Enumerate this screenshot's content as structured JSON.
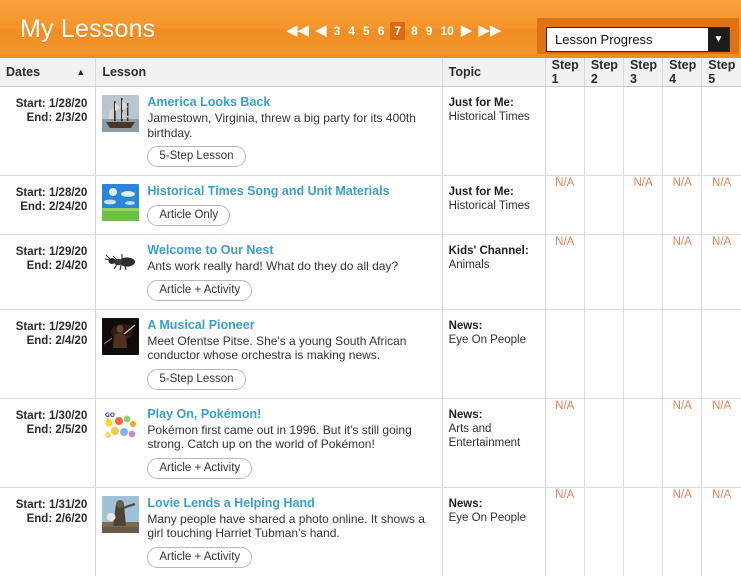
{
  "header": {
    "title": "My Lessons",
    "accent_color": "#f08c22",
    "pagination": {
      "first_icon": "double-left-arrow-icon",
      "prev_icon": "left-arrow-icon",
      "next_icon": "right-arrow-icon",
      "last_icon": "double-right-arrow-icon",
      "pages": [
        "3",
        "4",
        "5",
        "6",
        "7",
        "8",
        "9",
        "10"
      ],
      "current_page": "7"
    },
    "dropdown": {
      "selected": "Lesson Progress",
      "arrow_icon": "chevron-down-icon",
      "options": [
        "Lesson Progress"
      ]
    }
  },
  "table": {
    "columns": {
      "dates": "Dates",
      "sort_icon": "sort-ascending-icon",
      "lesson": "Lesson",
      "topic": "Topic",
      "steps": [
        "Step 1",
        "Step 2",
        "Step 3",
        "Step 4",
        "Step 5"
      ]
    },
    "labels": {
      "start": "Start:",
      "end": "End:"
    },
    "rows": [
      {
        "start": "1/28/20",
        "end": "2/3/20",
        "thumb": "sailing-ship-thumbnail",
        "title": "America Looks Back",
        "desc": "Jamestown, Virginia, threw a big party for its 400th birthday.",
        "pill": "5-Step Lesson",
        "topic_cat": "Just for Me:",
        "topic_sub": "Historical Times",
        "steps": [
          "",
          "",
          "",
          "",
          ""
        ]
      },
      {
        "start": "1/28/20",
        "end": "2/24/20",
        "thumb": "blue-sky-field-thumbnail",
        "title": "Historical Times Song and Unit Materials",
        "desc": "",
        "pill": "Article Only",
        "topic_cat": "Just for Me:",
        "topic_sub": "Historical Times",
        "steps": [
          "N/A",
          "",
          "N/A",
          "N/A",
          "N/A"
        ]
      },
      {
        "start": "1/29/20",
        "end": "2/4/20",
        "thumb": "ant-thumbnail",
        "title": "Welcome to Our Nest",
        "desc": "Ants work really hard! What do they do all day?",
        "pill": "Article + Activity",
        "topic_cat": "Kids' Channel:",
        "topic_sub": "Animals",
        "steps": [
          "N/A",
          "",
          "",
          "N/A",
          "N/A"
        ]
      },
      {
        "start": "1/29/20",
        "end": "2/4/20",
        "thumb": "conductor-thumbnail",
        "title": "A Musical Pioneer",
        "desc": "Meet Ofentse Pitse. She's a young South African conductor whose orchestra is making news.",
        "pill": "5-Step Lesson",
        "topic_cat": "News:",
        "topic_sub": "Eye On People",
        "steps": [
          "",
          "",
          "",
          "",
          ""
        ]
      },
      {
        "start": "1/30/20",
        "end": "2/5/20",
        "thumb": "pokemon-thumbnail",
        "title": "Play On, Pokémon!",
        "desc": "Pokémon first came out in 1996. But it's still going strong. Catch up on the world of Pokémon!",
        "pill": "Article + Activity",
        "topic_cat": "News:",
        "topic_sub": "Arts and Entertainment",
        "steps": [
          "N/A",
          "",
          "",
          "N/A",
          "N/A"
        ]
      },
      {
        "start": "1/31/20",
        "end": "2/6/20",
        "thumb": "harriet-tubman-statue-thumbnail",
        "title": "Lovie Lends a Helping Hand",
        "desc": "Many people have shared a photo online. It shows a girl touching Harriet Tubman's hand.",
        "pill": "Article + Activity",
        "topic_cat": "News:",
        "topic_sub": "Eye On People",
        "steps": [
          "N/A",
          "",
          "",
          "N/A",
          "N/A"
        ]
      }
    ]
  }
}
